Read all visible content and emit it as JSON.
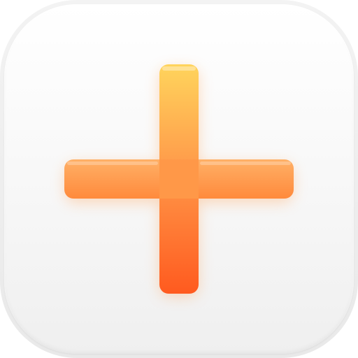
{
  "icon": {
    "name": "plus-icon",
    "colors": {
      "tile_top": "#ffffff",
      "tile_bottom": "#efefef",
      "plus_top": "#ffd45c",
      "plus_mid": "#ff9a4a",
      "plus_bottom": "#ff5a1f"
    }
  }
}
